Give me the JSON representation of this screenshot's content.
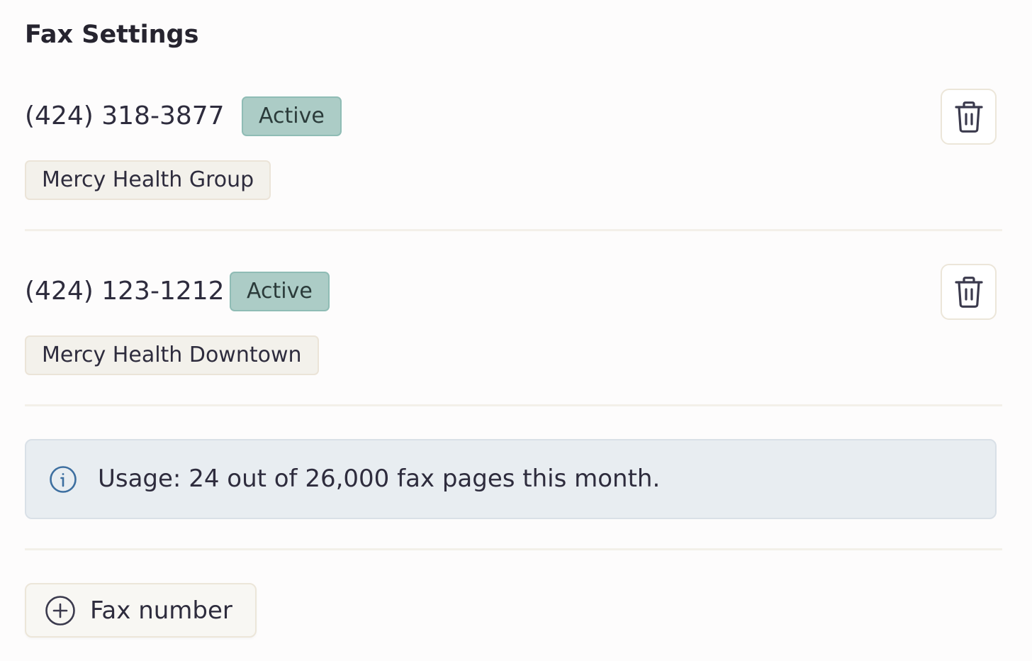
{
  "page": {
    "title": "Fax Settings"
  },
  "fax_numbers": [
    {
      "number": "(424) 318-3877",
      "status": "Active",
      "organization": "Mercy Health Group"
    },
    {
      "number": "(424) 123-1212",
      "status": "Active",
      "organization": "Mercy Health Downtown"
    }
  ],
  "usage": {
    "text": "Usage: 24 out of 26,000 fax pages this month.",
    "icon": "info-icon"
  },
  "add_button": {
    "label": "Fax number",
    "icon": "plus-circle-icon"
  },
  "colors": {
    "active_badge": "#acccc6",
    "org_tag": "#f3f1eb",
    "usage_box": "#e8edf1",
    "info_icon": "#3d6fa0"
  }
}
